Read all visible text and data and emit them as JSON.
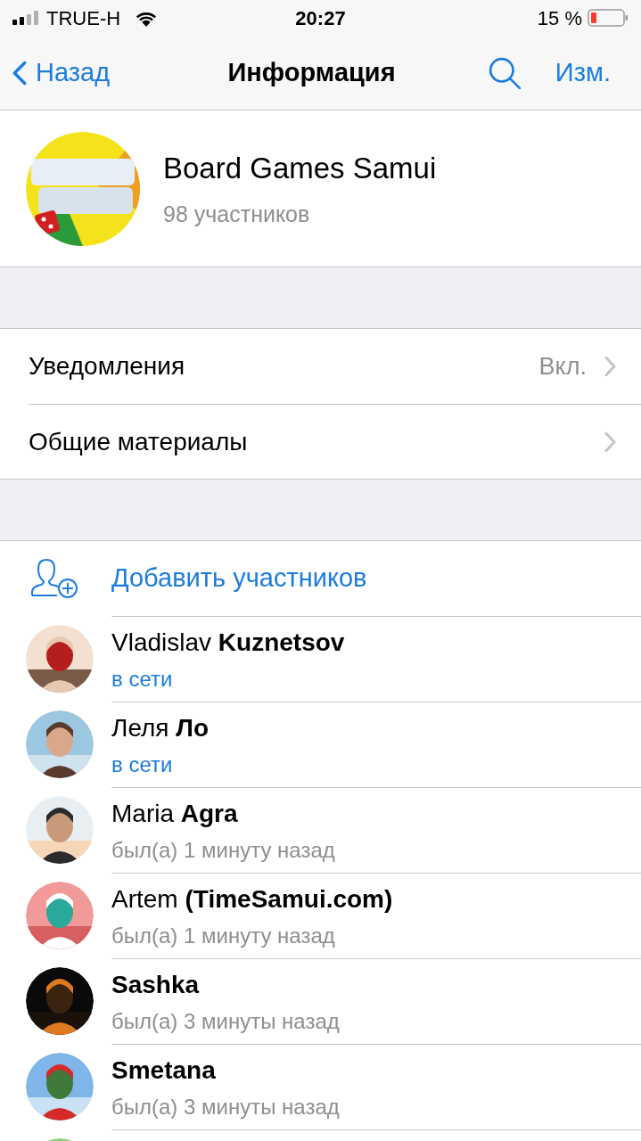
{
  "status_bar": {
    "carrier": "TRUE-H",
    "time": "20:27",
    "battery": "15 %"
  },
  "nav": {
    "back": "Назад",
    "title": "Информация",
    "edit": "Изм."
  },
  "group": {
    "name": "Board Games Samui",
    "members": "98 участников"
  },
  "settings": [
    {
      "label": "Уведомления",
      "value": "Вкл."
    },
    {
      "label": "Общие материалы"
    }
  ],
  "add_members": "Добавить участников",
  "members": [
    {
      "name_regular": "Vladislav",
      "name_emphasized": "Kuznetsov",
      "status": "в сети",
      "online": true
    },
    {
      "name_regular": "Леля",
      "name_emphasized": "Ло",
      "status": "в сети",
      "online": true
    },
    {
      "name_regular": "Maria",
      "name_emphasized": "Agra",
      "status": "был(а) 1 минуту назад",
      "online": false
    },
    {
      "name_regular": "Artem",
      "name_emphasized": "(TimeSamui.com)",
      "status": "был(а) 1 минуту назад",
      "online": false
    },
    {
      "name_emphasized": "Sashka",
      "status": "был(а) 3 минуты назад",
      "online": false
    },
    {
      "name_emphasized": "Smetana",
      "status": "был(а) 3 минуты назад",
      "online": false
    }
  ]
}
